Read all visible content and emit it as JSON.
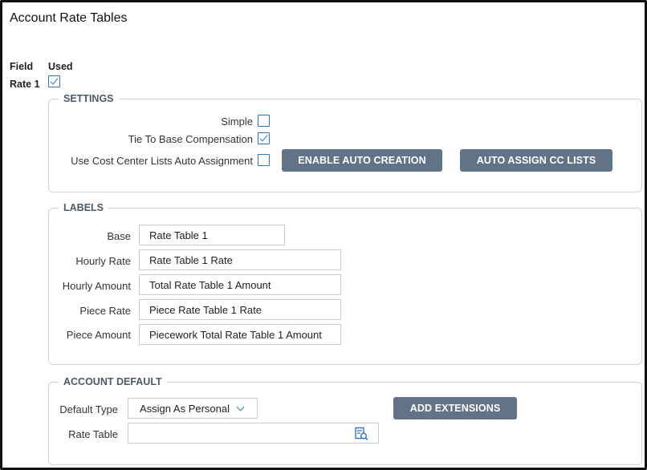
{
  "page": {
    "title": "Account Rate Tables"
  },
  "columns": {
    "field": "Field",
    "used": "Used"
  },
  "rows": [
    {
      "label": "Rate 1",
      "used": true
    }
  ],
  "settings": {
    "legend": "SETTINGS",
    "simple_label": "Simple",
    "simple_checked": false,
    "tie_label": "Tie To Base Compensation",
    "tie_checked": true,
    "cost_center_label": "Use Cost Center Lists Auto Assignment",
    "cost_center_checked": false,
    "enable_auto_creation": "ENABLE AUTO CREATION",
    "auto_assign_cc_lists": "AUTO ASSIGN CC LISTS"
  },
  "labels": {
    "legend": "LABELS",
    "items": [
      {
        "label": "Base",
        "value": "Rate Table 1"
      },
      {
        "label": "Hourly Rate",
        "value": "Rate Table 1 Rate"
      },
      {
        "label": "Hourly Amount",
        "value": "Total Rate Table 1 Amount"
      },
      {
        "label": "Piece Rate",
        "value": "Piece Rate Table 1 Rate"
      },
      {
        "label": "Piece Amount",
        "value": "Piecework Total Rate Table 1 Amount"
      }
    ]
  },
  "account_default": {
    "legend": "ACCOUNT DEFAULT",
    "default_type_label": "Default Type",
    "default_type_value": "Assign As Personal",
    "add_extensions": "ADD EXTENSIONS",
    "rate_table_label": "Rate Table",
    "rate_table_value": ""
  },
  "colors": {
    "accent": "#2f72c4",
    "button": "#627388",
    "border": "#cfd2d6"
  },
  "icons": {
    "lookup": "lookup-icon",
    "dropdown": "chevron-down-icon"
  }
}
